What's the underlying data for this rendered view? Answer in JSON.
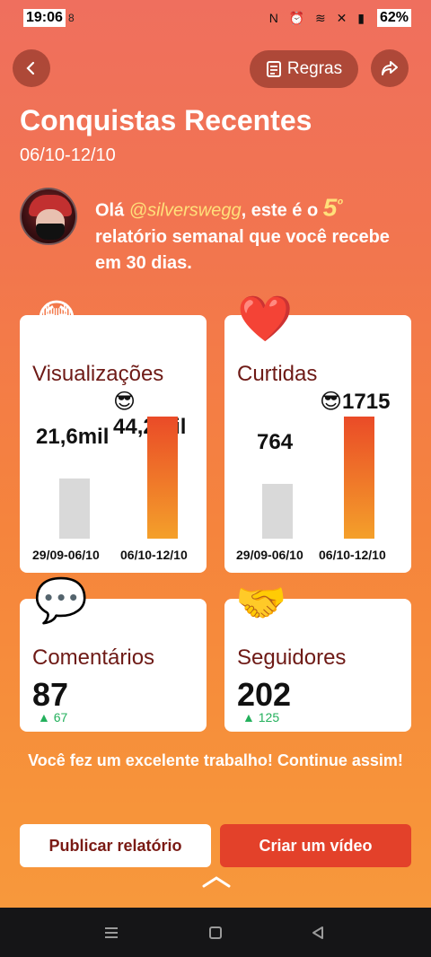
{
  "status": {
    "time": "19:06",
    "small_icon": "8",
    "icons": "N ⏰ ≋ ✕ ▮",
    "battery": "62%"
  },
  "header": {
    "rules_label": "Regras",
    "title": "Conquistas Recentes",
    "date_range": "06/10-12/10"
  },
  "greeting": {
    "prefix": "Olá ",
    "username": "@silverswegg",
    "middle": ", este é o ",
    "number": "5",
    "suffix_sup": "º",
    "rest": " relatório semanal que você recebe em 30 dias."
  },
  "cards": {
    "views": {
      "label": "Visualizações",
      "current_value": "44,2mil",
      "previous_value": "21,6mil",
      "previous_period": "29/09-06/10",
      "current_period": "06/10-12/10",
      "previous_fraction": 0.49,
      "current_fraction": 1.0
    },
    "likes": {
      "label": "Curtidas",
      "current_value": "1715",
      "previous_value": "764",
      "previous_period": "29/09-06/10",
      "current_period": "06/10-12/10",
      "previous_fraction": 0.45,
      "current_fraction": 1.0
    },
    "comments": {
      "label": "Comentários",
      "value": "87",
      "delta": "67"
    },
    "followers": {
      "label": "Seguidores",
      "value": "202",
      "delta": "125"
    }
  },
  "encouragement": "Você fez um excelente trabalho! Continue assim!",
  "buttons": {
    "publish": "Publicar relatório",
    "create_video": "Criar um vídeo"
  },
  "colors": {
    "accent_red": "#e3412a",
    "label_brown": "#6e1a16",
    "delta_green": "#23b05c"
  }
}
